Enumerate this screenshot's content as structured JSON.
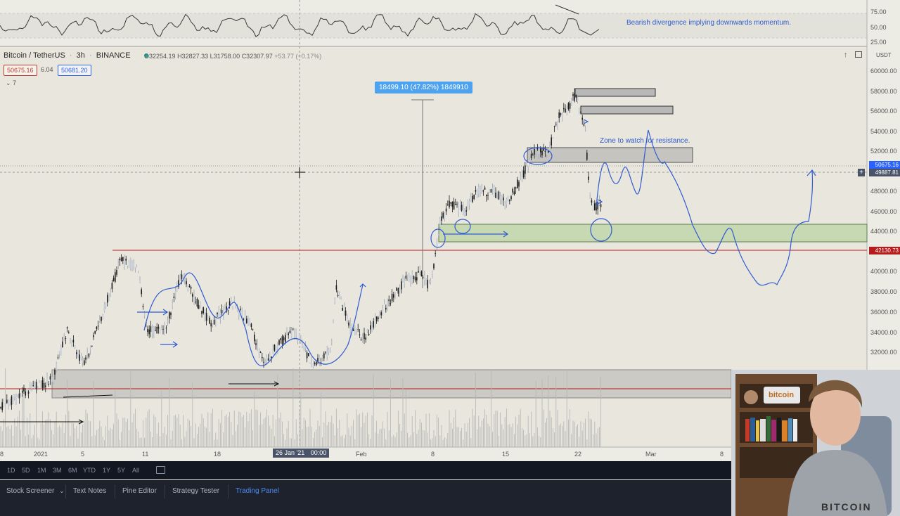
{
  "legend": {
    "symbol": "Bitcoin / TetherUS",
    "interval": "3h",
    "exchange": "BINANCE",
    "open": "O32254.19",
    "high": "H32827.33",
    "low": "L31758.00",
    "close": "C32307.97",
    "change": "+53.77 (+0.17%)",
    "sell_price": "50675.16",
    "spread": "6.04",
    "buy_price": "50681.20",
    "indicators_count": "7"
  },
  "annotations": {
    "rsi_note": "Bearish divergence implying downwards momentum.",
    "zone_note": "Zone to watch for resistance.",
    "measure": "18499.10 (47.82%) 1849910"
  },
  "rsi_axis": [
    "75.00",
    "50.00",
    "25.00"
  ],
  "price_axis": {
    "unit": "USDT",
    "labels": [
      "60000.00",
      "58000.00",
      "56000.00",
      "54000.00",
      "52000.00",
      "48000.00",
      "46000.00",
      "44000.00",
      "40000.00",
      "38000.00",
      "36000.00",
      "34000.00",
      "32000.00"
    ],
    "current_price": "50675.16",
    "crosshair_price": "49887.81",
    "horizontal_line_price": "42130.73",
    "current_color": "#2962ff",
    "line_color": "#b71c1c"
  },
  "time_axis": {
    "labels": [
      "8",
      "2021",
      "5",
      "11",
      "18",
      "Feb",
      "8",
      "15",
      "22",
      "Mar",
      "8"
    ],
    "cursor_date": "26 Jan '21",
    "cursor_time": "00:00"
  },
  "timeframes": [
    "1D",
    "5D",
    "1M",
    "3M",
    "6M",
    "YTD",
    "1Y",
    "5Y",
    "All"
  ],
  "tabs": [
    "Stock Screener",
    "Text Notes",
    "Pine Editor",
    "Strategy Tester",
    "Trading Panel"
  ],
  "active_tab": "Trading Panel",
  "webcam": {
    "sign_text": "bitcoin",
    "shirt_text": "BITCOIN"
  }
}
